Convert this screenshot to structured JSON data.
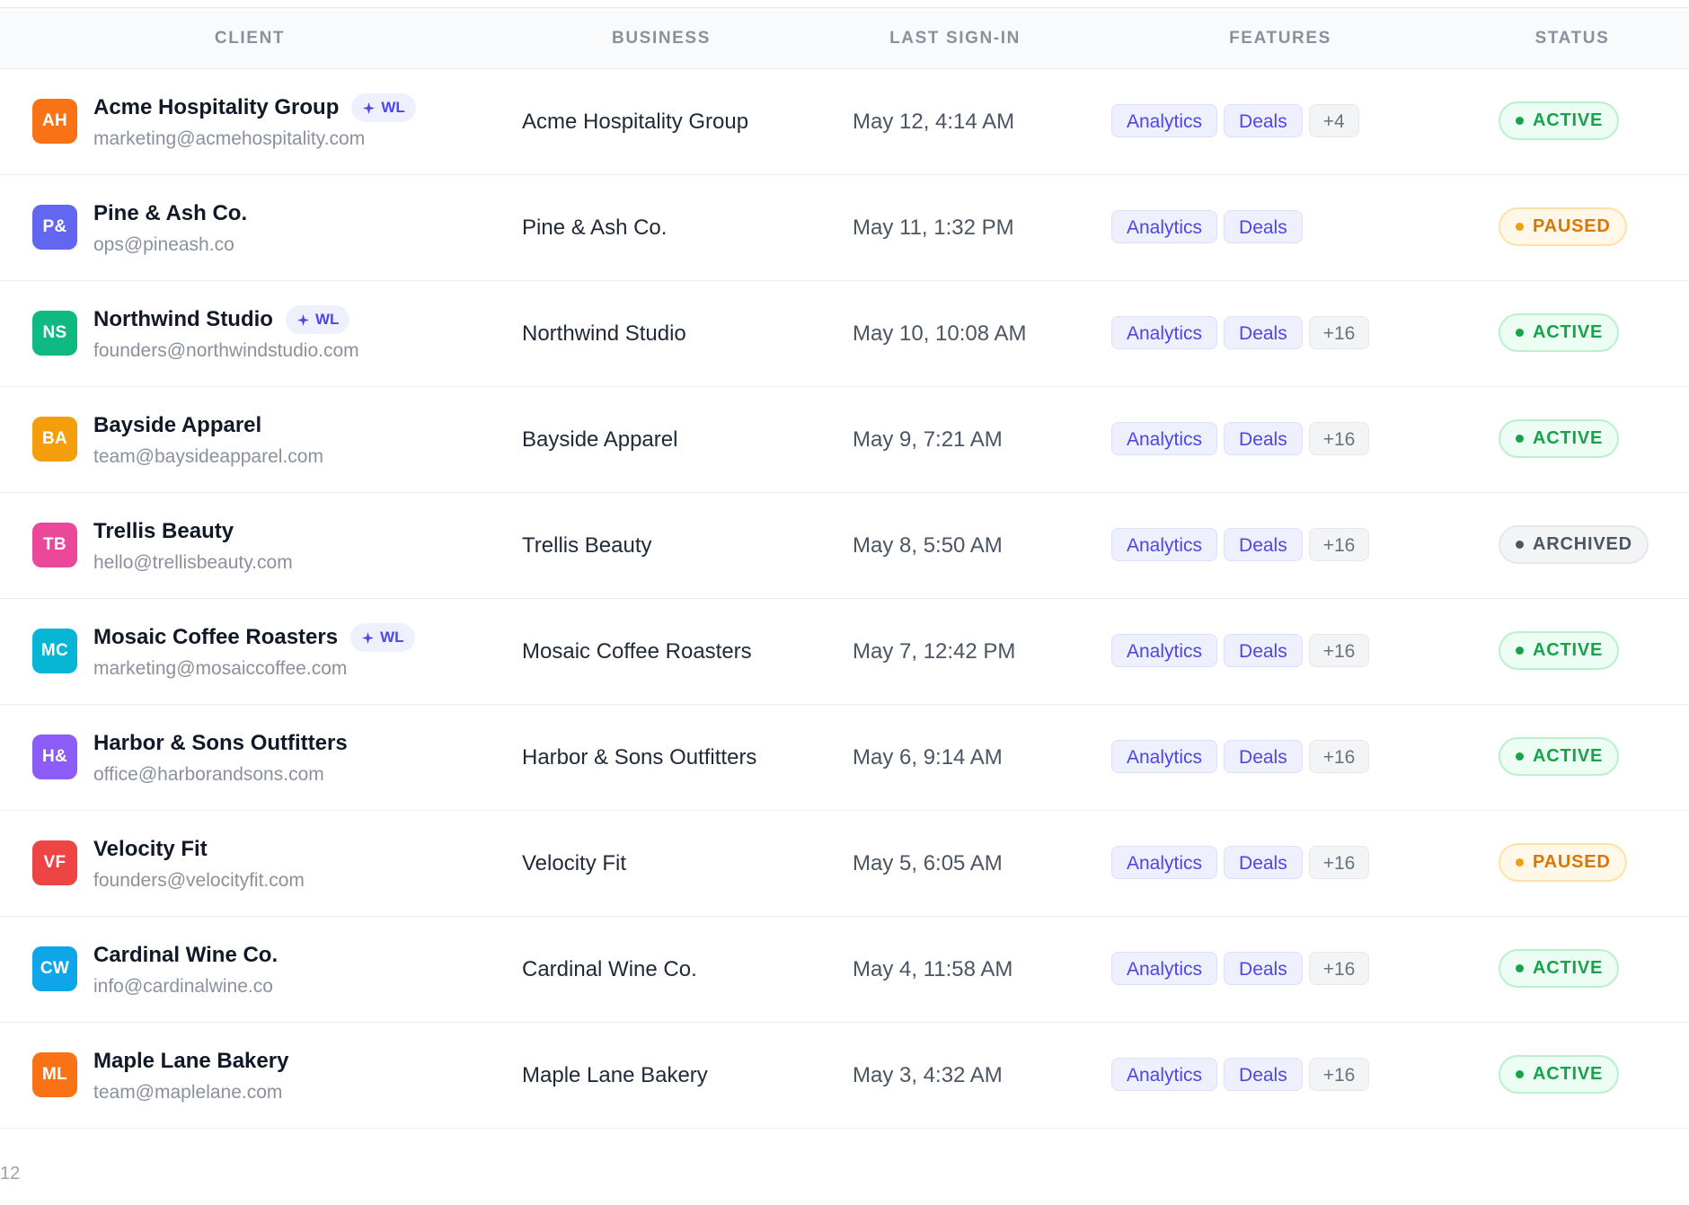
{
  "columns": {
    "client": "CLIENT",
    "business": "BUSINESS",
    "last_sign_in": "LAST SIGN-IN",
    "features": "FEATURES",
    "status": "STATUS"
  },
  "wl_label": "WL",
  "status_colors": {
    "active": "#16a34a",
    "paused": "#d97706",
    "archived": "#4b5563"
  },
  "rows": [
    {
      "initials": "AH",
      "avatar_color": "#f97316",
      "name": "Acme Hospitality Group",
      "wl": true,
      "email": "marketing@acmehospitality.com",
      "business": "Acme Hospitality Group",
      "last_sign_in": "May 12, 4:14 AM",
      "features": [
        "Analytics",
        "Deals"
      ],
      "more": "+4",
      "status": "ACTIVE",
      "status_kind": "active"
    },
    {
      "initials": "P&",
      "avatar_color": "#6366f1",
      "name": "Pine & Ash Co.",
      "wl": false,
      "email": "ops@pineash.co",
      "business": "Pine & Ash Co.",
      "last_sign_in": "May 11, 1:32 PM",
      "features": [
        "Analytics",
        "Deals"
      ],
      "more": "",
      "status": "PAUSED",
      "status_kind": "paused"
    },
    {
      "initials": "NS",
      "avatar_color": "#10b981",
      "name": "Northwind Studio",
      "wl": true,
      "email": "founders@northwindstudio.com",
      "business": "Northwind Studio",
      "last_sign_in": "May 10, 10:08 AM",
      "features": [
        "Analytics",
        "Deals"
      ],
      "more": "+16",
      "status": "ACTIVE",
      "status_kind": "active"
    },
    {
      "initials": "BA",
      "avatar_color": "#f59e0b",
      "name": "Bayside Apparel",
      "wl": false,
      "email": "team@baysideapparel.com",
      "business": "Bayside Apparel",
      "last_sign_in": "May 9, 7:21 AM",
      "features": [
        "Analytics",
        "Deals"
      ],
      "more": "+16",
      "status": "ACTIVE",
      "status_kind": "active"
    },
    {
      "initials": "TB",
      "avatar_color": "#ec4899",
      "name": "Trellis Beauty",
      "wl": false,
      "email": "hello@trellisbeauty.com",
      "business": "Trellis Beauty",
      "last_sign_in": "May 8, 5:50 AM",
      "features": [
        "Analytics",
        "Deals"
      ],
      "more": "+16",
      "status": "ARCHIVED",
      "status_kind": "archived"
    },
    {
      "initials": "MC",
      "avatar_color": "#06b6d4",
      "name": "Mosaic Coffee Roasters",
      "wl": true,
      "email": "marketing@mosaiccoffee.com",
      "business": "Mosaic Coffee Roasters",
      "last_sign_in": "May 7, 12:42 PM",
      "features": [
        "Analytics",
        "Deals"
      ],
      "more": "+16",
      "status": "ACTIVE",
      "status_kind": "active"
    },
    {
      "initials": "H&",
      "avatar_color": "#8b5cf6",
      "name": "Harbor & Sons Outfitters",
      "wl": false,
      "email": "office@harborandsons.com",
      "business": "Harbor & Sons Outfitters",
      "last_sign_in": "May 6, 9:14 AM",
      "features": [
        "Analytics",
        "Deals"
      ],
      "more": "+16",
      "status": "ACTIVE",
      "status_kind": "active"
    },
    {
      "initials": "VF",
      "avatar_color": "#ef4444",
      "name": "Velocity Fit",
      "wl": false,
      "email": "founders@velocityfit.com",
      "business": "Velocity Fit",
      "last_sign_in": "May 5, 6:05 AM",
      "features": [
        "Analytics",
        "Deals"
      ],
      "more": "+16",
      "status": "PAUSED",
      "status_kind": "paused"
    },
    {
      "initials": "CW",
      "avatar_color": "#0ea5e9",
      "name": "Cardinal Wine Co.",
      "wl": false,
      "email": "info@cardinalwine.co",
      "business": "Cardinal Wine Co.",
      "last_sign_in": "May 4, 11:58 AM",
      "features": [
        "Analytics",
        "Deals"
      ],
      "more": "+16",
      "status": "ACTIVE",
      "status_kind": "active"
    },
    {
      "initials": "ML",
      "avatar_color": "#f97316",
      "name": "Maple Lane Bakery",
      "wl": false,
      "email": "team@maplelane.com",
      "business": "Maple Lane Bakery",
      "last_sign_in": "May 3, 4:32 AM",
      "features": [
        "Analytics",
        "Deals"
      ],
      "more": "+16",
      "status": "ACTIVE",
      "status_kind": "active"
    }
  ],
  "footer": {
    "count_text": "12"
  }
}
